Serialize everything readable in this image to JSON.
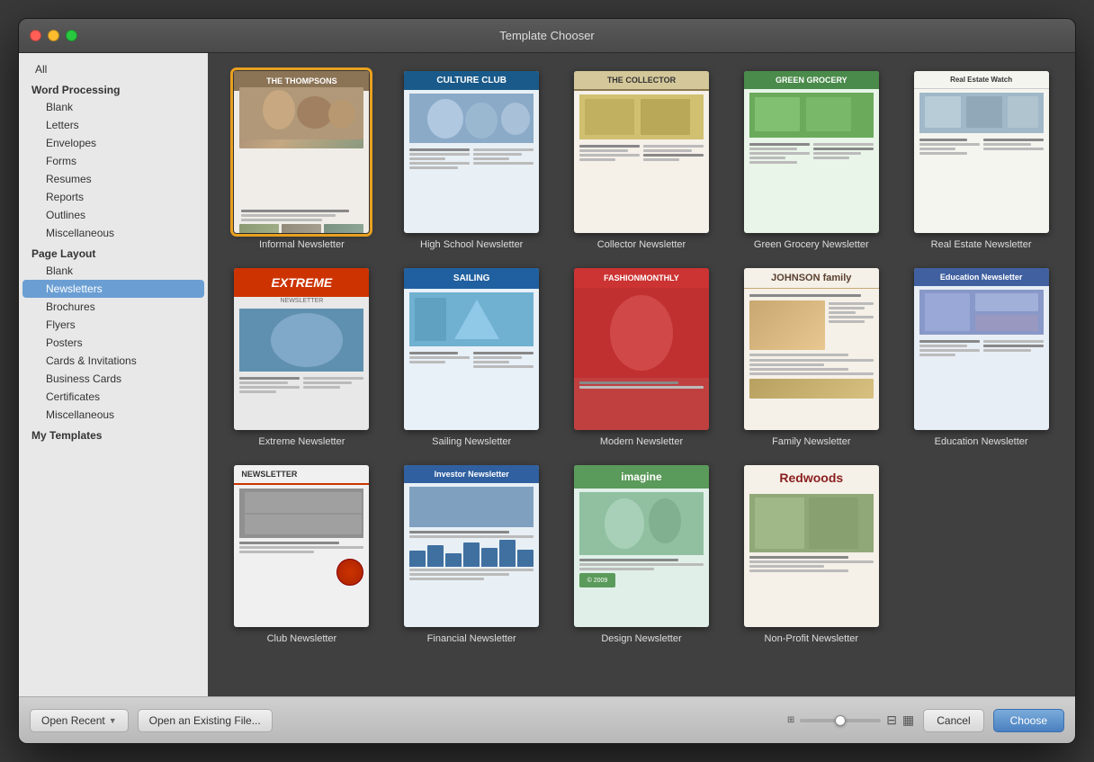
{
  "window": {
    "title": "Template Chooser"
  },
  "sidebar": {
    "all_label": "All",
    "categories": [
      {
        "name": "Word Processing",
        "items": [
          "Blank",
          "Letters",
          "Envelopes",
          "Forms",
          "Resumes",
          "Reports",
          "Outlines",
          "Miscellaneous"
        ]
      },
      {
        "name": "Page Layout",
        "items": [
          "Blank",
          "Newsletters",
          "Brochures",
          "Flyers",
          "Posters",
          "Cards & Invitations",
          "Business Cards",
          "Certificates",
          "Miscellaneous"
        ]
      },
      {
        "name": "My Templates",
        "items": []
      }
    ],
    "selected": "Newsletters"
  },
  "templates": {
    "row1": [
      {
        "id": "informal",
        "label": "Informal Newsletter",
        "selected": true
      },
      {
        "id": "highschool",
        "label": "High School Newsletter",
        "selected": false
      },
      {
        "id": "collector",
        "label": "Collector Newsletter",
        "selected": false
      },
      {
        "id": "grocery",
        "label": "Green Grocery Newsletter",
        "selected": false
      },
      {
        "id": "realestate",
        "label": "Real Estate Newsletter",
        "selected": false
      }
    ],
    "row2": [
      {
        "id": "extreme",
        "label": "Extreme Newsletter",
        "selected": false
      },
      {
        "id": "sailing",
        "label": "Sailing Newsletter",
        "selected": false
      },
      {
        "id": "modern",
        "label": "Modern Newsletter",
        "selected": false
      },
      {
        "id": "family",
        "label": "Family Newsletter",
        "selected": false
      },
      {
        "id": "education",
        "label": "Education Newsletter",
        "selected": false
      }
    ],
    "row3": [
      {
        "id": "club",
        "label": "Club Newsletter",
        "selected": false
      },
      {
        "id": "financial",
        "label": "Financial Newsletter",
        "selected": false
      },
      {
        "id": "design",
        "label": "Design Newsletter",
        "selected": false
      },
      {
        "id": "nonprofit",
        "label": "Non-Profit Newsletter",
        "selected": false
      }
    ]
  },
  "toolbar": {
    "open_recent": "Open Recent",
    "open_existing": "Open an Existing File...",
    "cancel": "Cancel",
    "choose": "Choose"
  }
}
